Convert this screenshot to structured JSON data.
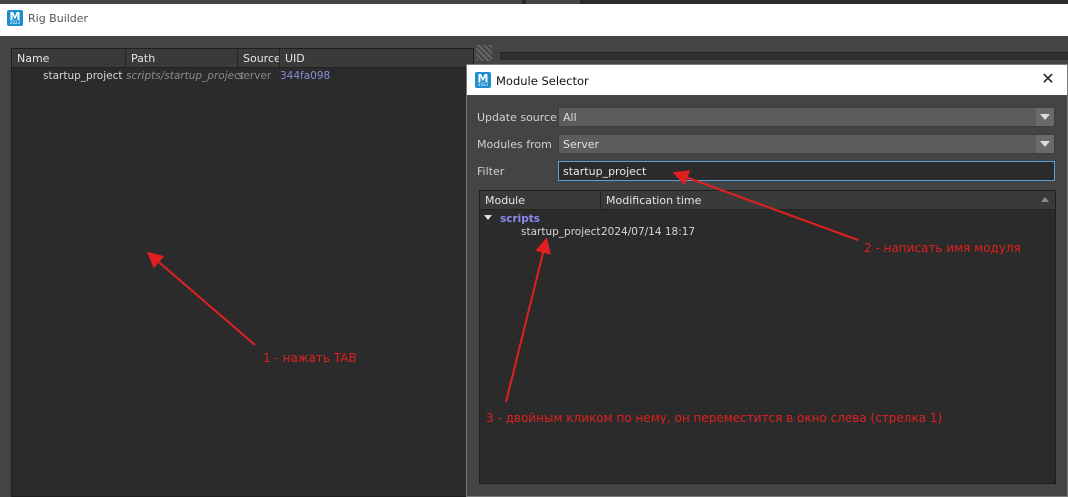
{
  "main_window": {
    "title": "Rig Builder",
    "icon": "maya-icon",
    "icon_letter": "M",
    "icon_subtext": "2023"
  },
  "left_table": {
    "columns": [
      "Name",
      "Path",
      "Source",
      "UID"
    ],
    "rows": [
      {
        "name": "startup_project",
        "path": "scripts/startup_project",
        "source": "server",
        "uid": "344fa098"
      }
    ]
  },
  "dialog": {
    "title": "Module Selector",
    "icon": "maya-icon",
    "close_icon": "close-icon",
    "update_source_label": "Update source",
    "update_source_value": "All",
    "modules_from_label": "Modules from",
    "modules_from_value": "Server",
    "filter_label": "Filter",
    "filter_value": "startup_project",
    "tree": {
      "columns": [
        "Module",
        "Modification time"
      ],
      "groups": [
        {
          "name": "scripts",
          "items": [
            {
              "module": "startup_project",
              "modified": "2024/07/14 18:17"
            }
          ]
        }
      ]
    }
  },
  "annotations": {
    "step1": "1 - нажать TAB",
    "step2": "2 - написать имя модуля",
    "step3": "3 - двойным кликом по нему, он переместится в окно слева (стрелка 1)",
    "color": "#e02020"
  }
}
